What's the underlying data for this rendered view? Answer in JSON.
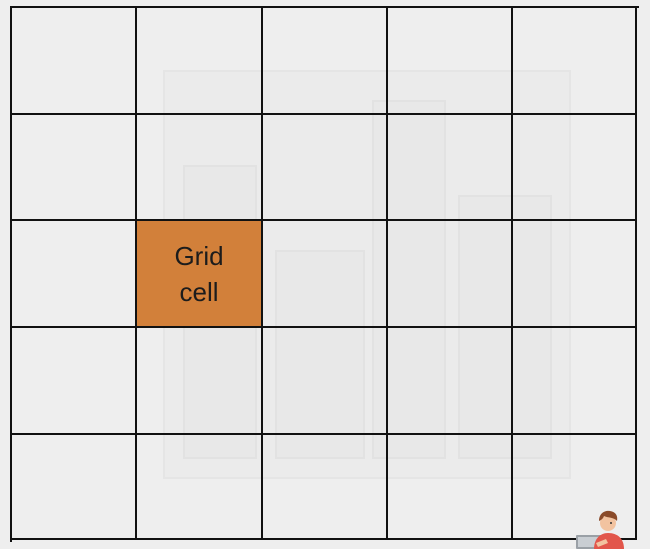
{
  "grid": {
    "rows": 5,
    "columns": 5,
    "highlighted_cell": {
      "row": 3,
      "column": 2
    },
    "highlight_label": "Grid cell",
    "line_color": "#111111",
    "highlight_color": "#d2803a",
    "background_color": "#eeeeee"
  },
  "mascot": {
    "icon": "person-with-laptop-icon"
  }
}
